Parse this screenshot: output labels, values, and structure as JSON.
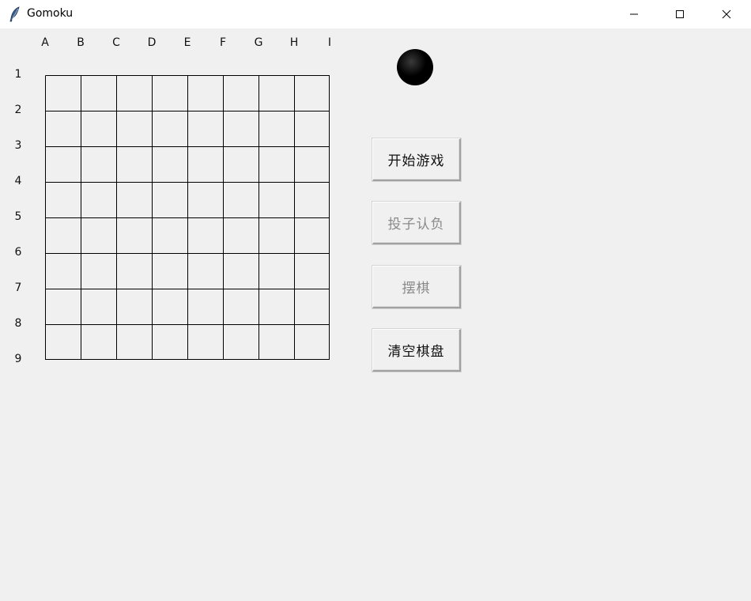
{
  "window": {
    "title": "Gomoku",
    "icon": "feather-icon",
    "controls": [
      "minimize-icon",
      "maximize-icon",
      "close-icon"
    ]
  },
  "board": {
    "columns": [
      "A",
      "B",
      "C",
      "D",
      "E",
      "F",
      "G",
      "H",
      "I"
    ],
    "rows": [
      "1",
      "2",
      "3",
      "4",
      "5",
      "6",
      "7",
      "8",
      "9"
    ],
    "line_color": "#000000"
  },
  "turn_indicator": {
    "stone_color": "black"
  },
  "buttons": {
    "start": {
      "label": "开始游戏",
      "enabled": true
    },
    "resign": {
      "label": "投子认负",
      "enabled": false
    },
    "place": {
      "label": "摆棋",
      "enabled": false
    },
    "clear": {
      "label": "清空棋盘",
      "enabled": true
    }
  }
}
